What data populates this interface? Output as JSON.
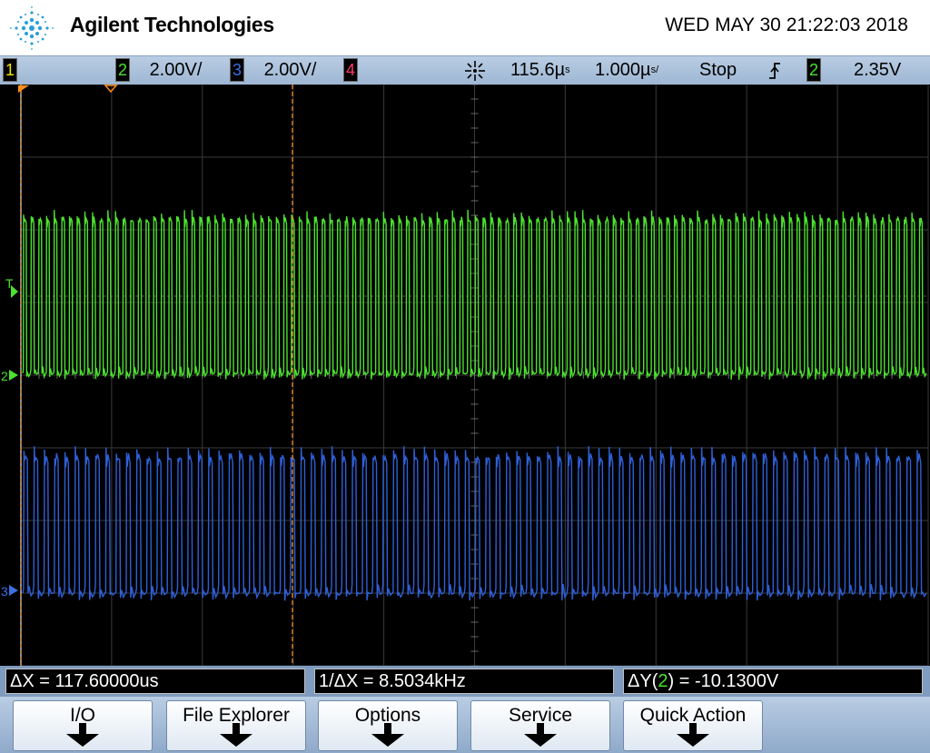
{
  "header": {
    "brand": "Agilent Technologies",
    "datetime": "WED MAY 30 21:22:03 2018",
    "logo_icon": "agilent-spark-icon"
  },
  "status": {
    "ch1": {
      "num": "1",
      "color": "#f2e600"
    },
    "ch2": {
      "num": "2",
      "scale": "2.00V/",
      "color": "#4ce12e"
    },
    "ch3": {
      "num": "3",
      "scale": "2.00V/",
      "color": "#3d6fe0"
    },
    "ch4": {
      "num": "4",
      "color": "#ff3a6b"
    },
    "time_delay": "115.6µ",
    "delay_unit": "s",
    "time_scale": "1.000µ",
    "scale_unit": "s/",
    "run_state": "Stop",
    "trigger_icon": "rising-edge-icon",
    "trigger_source": "2",
    "trigger_level": "2.35V"
  },
  "screen": {
    "trigger_marker": "T",
    "ch2_marker": "2",
    "ch3_marker": "3",
    "ch2_color": "#4ce12e",
    "ch3_color": "#2f5fd6",
    "cursor_color": "#ff8c1a"
  },
  "measurements": {
    "dx": "ΔX = 117.60000us",
    "inv_dx": "1/ΔX = 8.5034kHz",
    "dy_prefix": "ΔY(",
    "dy_channel": "2",
    "dy_suffix": ") = -10.1300V"
  },
  "softkeys": [
    {
      "label": "I/O"
    },
    {
      "label": "File Explorer"
    },
    {
      "label": "Options"
    },
    {
      "label": "Service"
    },
    {
      "label": "Quick Action"
    }
  ]
}
